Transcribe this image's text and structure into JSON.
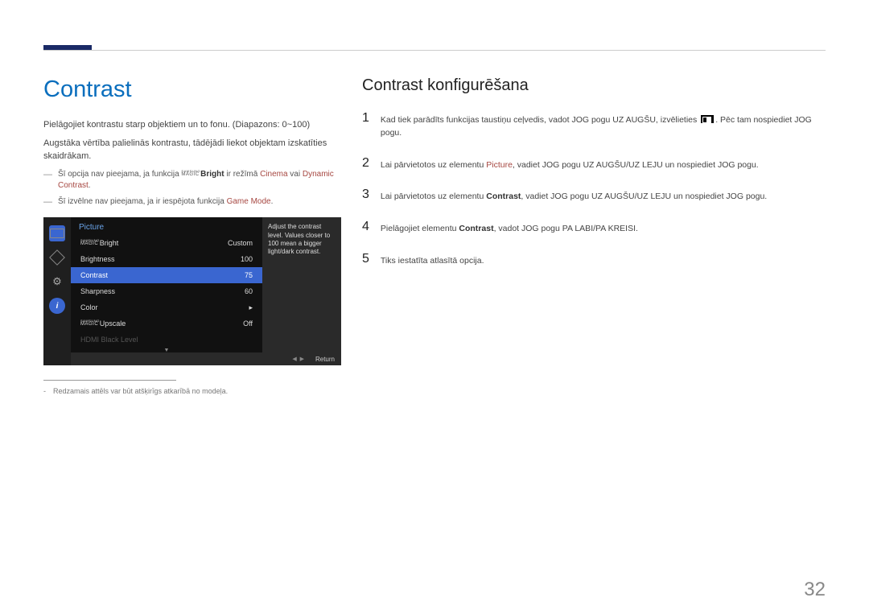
{
  "page_number": "32",
  "left": {
    "title": "Contrast",
    "p1": "Pielāgojiet kontrastu starp objektiem un to fonu. (Diapazons: 0~100)",
    "p2": "Augstāka vērtība palielinās kontrastu, tādējādi liekot objektam izskatīties skaidrākam.",
    "note1_pre": "Šī opcija nav pieejama, ja funkcija ",
    "note1_magic_top": "SAMSUNG",
    "note1_magic_bot": "MAGIC",
    "note1_bright": "Bright",
    "note1_mid": " ir režīmā ",
    "note1_cinema": "Cinema",
    "note1_or": " vai ",
    "note1_dc": "Dynamic Contrast",
    "note1_end": ".",
    "note2_pre": "Šī izvēlne nav pieejama, ja ir iespējota funkcija ",
    "note2_gm": "Game Mode",
    "note2_end": ".",
    "footnote": "Redzamais attēls var būt atšķirīgs atkarībā no modeļa."
  },
  "osd": {
    "title": "Picture",
    "help": "Adjust the contrast level. Values closer to 100 mean a bigger light/dark contrast.",
    "rows": [
      {
        "label_pre": "",
        "magic": true,
        "label": "Bright",
        "value": "Custom"
      },
      {
        "label": "Brightness",
        "value": "100"
      },
      {
        "label": "Contrast",
        "value": "75",
        "selected": true
      },
      {
        "label": "Sharpness",
        "value": "60"
      },
      {
        "label": "Color",
        "value": "",
        "arrow": true
      },
      {
        "label_pre": "",
        "magic": true,
        "label": "Upscale",
        "value": "Off"
      },
      {
        "label": "HDMI Black Level",
        "value": "",
        "disabled": true
      }
    ],
    "return": "Return"
  },
  "right": {
    "title": "Contrast konfigurēšana",
    "steps": {
      "s1_a": "Kad tiek parādīts funkcijas taustiņu ceļvedis, vadot JOG pogu UZ AUGŠU, izvēlieties ",
      "s1_b": ". Pēc tam nospiediet JOG pogu.",
      "s2_a": "Lai pārvietotos uz elementu ",
      "s2_pic": "Picture",
      "s2_b": ", vadiet JOG pogu UZ AUGŠU/UZ LEJU un nospiediet JOG pogu.",
      "s3_a": "Lai pārvietotos uz elementu ",
      "s3_con": "Contrast",
      "s3_b": ", vadiet JOG pogu UZ AUGŠU/UZ LEJU un nospiediet JOG pogu.",
      "s4_a": "Pielāgojiet elementu ",
      "s4_con": "Contrast",
      "s4_b": ", vadot JOG pogu PA LABI/PA KREISI.",
      "s5": "Tiks iestatīta atlasītā opcija."
    }
  }
}
